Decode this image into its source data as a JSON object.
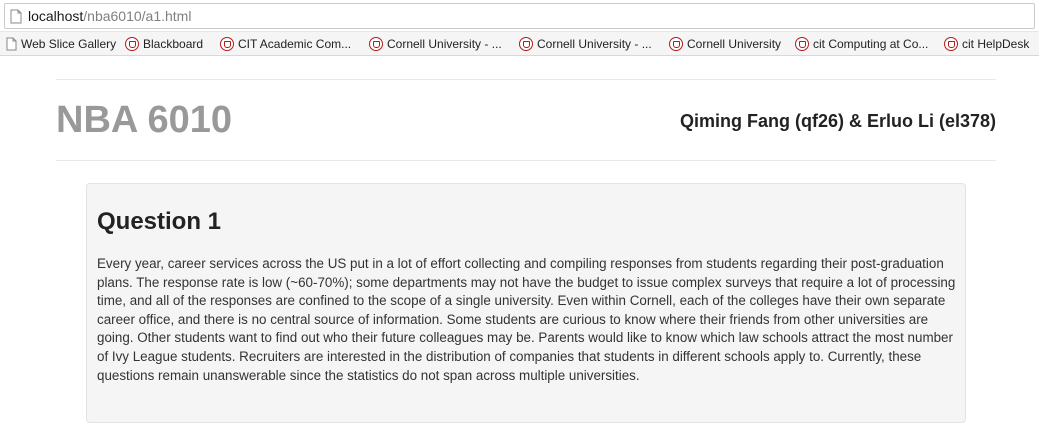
{
  "browser": {
    "url_host": "localhost",
    "url_path": "/nba6010/a1.html",
    "bookmarks": [
      {
        "label": "Web Slice Gallery",
        "icon": "page-icon"
      },
      {
        "label": "Blackboard",
        "icon": "cornell-shield-icon"
      },
      {
        "label": "CIT Academic Com...",
        "icon": "cornell-shield-icon"
      },
      {
        "label": "Cornell University - ...",
        "icon": "cornell-shield-icon"
      },
      {
        "label": "Cornell University - ...",
        "icon": "cornell-shield-icon"
      },
      {
        "label": "Cornell University",
        "icon": "cornell-shield-icon"
      },
      {
        "label": "cit Computing at Co...",
        "icon": "cornell-shield-icon"
      },
      {
        "label": "cit HelpDesk",
        "icon": "cornell-shield-icon"
      }
    ]
  },
  "header": {
    "title": "NBA 6010",
    "authors": "Qiming Fang (qf26) & Erluo Li (el378)"
  },
  "question": {
    "heading": "Question 1",
    "body": "Every year, career services across the US put in a lot of effort collecting and compiling responses from students regarding their post-graduation plans. The response rate is low (~60-70%); some departments may not have the budget to issue complex surveys that require a lot of processing time, and all of the responses are confined to the scope of a single university. Even within Cornell, each of the colleges have their own separate career office, and there is no central source of information. Some students are curious to know where their friends from other universities are going. Other students want to find out who their future colleagues may be. Parents would like to know which law schools attract the most number of Ivy League students. Recruiters are interested in the distribution of companies that students in different schools apply to. Currently, these questions remain unanswerable since the statistics do not span across multiple universities."
  },
  "colors": {
    "title_gray": "#999999",
    "well_bg": "#f5f5f5",
    "cornell_red": "#b31b1b"
  }
}
